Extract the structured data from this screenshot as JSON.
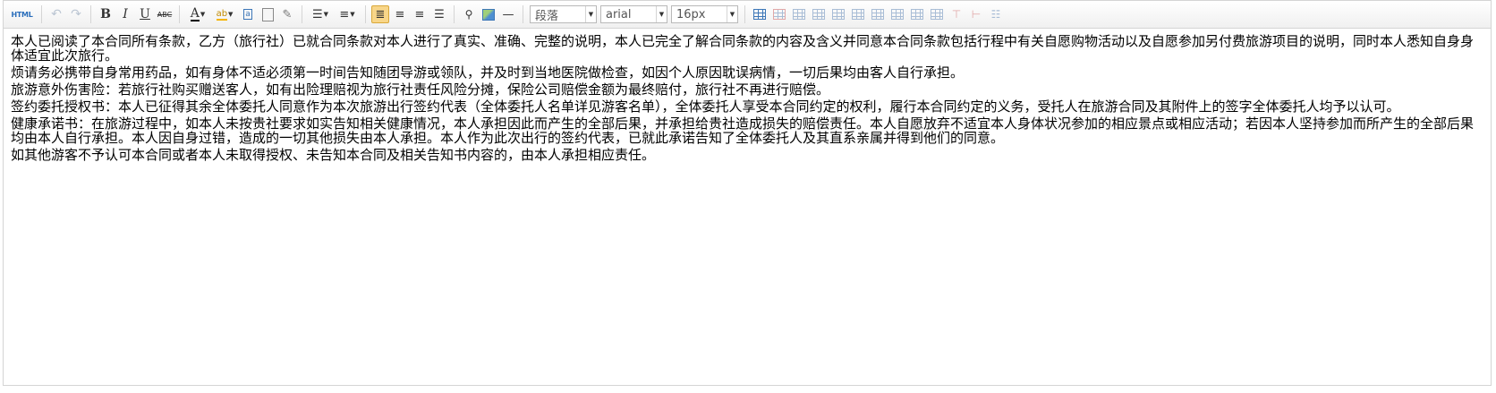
{
  "toolbar": {
    "html_label": "HTML",
    "paragraph_format": "段落",
    "font_family": "arial",
    "font_size": "16px",
    "bold": "B",
    "italic": "I",
    "underline": "U",
    "strike": "ABC",
    "font_color": "A",
    "background_color": "ab",
    "ruler": "—"
  },
  "content": {
    "paragraphs": [
      "本人已阅读了本合同所有条款，乙方（旅行社）已就合同条款对本人进行了真实、准确、完整的说明，本人已完全了解合同条款的内容及含义并同意本合同条款包括行程中有关自愿购物活动以及自愿参加另付费旅游项目的说明，同时本人悉知自身身体适宜此次旅行。",
      "烦请务必携带自身常用药品，如有身体不适必须第一时间告知随团导游或领队，并及时到当地医院做检查，如因个人原因耽误病情，一切后果均由客人自行承担。",
      "旅游意外伤害险：若旅行社购买赠送客人，如有出险理赔视为旅行社责任风险分摊，保险公司赔偿金额为最终赔付，旅行社不再进行赔偿。",
      "签约委托授权书：本人已征得其余全体委托人同意作为本次旅游出行签约代表（全体委托人名单详见游客名单），全体委托人享受本合同约定的权利，履行本合同约定的义务，受托人在旅游合同及其附件上的签字全体委托人均予以认可。",
      "健康承诺书：在旅游过程中，如本人未按贵社要求如实告知相关健康情况，本人承担因此而产生的全部后果，并承担给贵社造成损失的赔偿责任。本人自愿放弃不适宜本人身体状况参加的相应景点或相应活动；若因本人坚持参加而所产生的全部后果均由本人自行承担。本人因自身过错，造成的一切其他损失由本人承担。本人作为此次出行的签约代表，已就此承诺告知了全体委托人及其直系亲属并得到他们的同意。",
      "如其他游客不予认可本合同或者本人未取得授权、未告知本合同及相关告知书内容的，由本人承担相应责任。"
    ]
  },
  "colors": {
    "active_button": "#f8d689",
    "icon_blue": "#3d77b8",
    "disabled_icon": "#bcc6d3"
  }
}
